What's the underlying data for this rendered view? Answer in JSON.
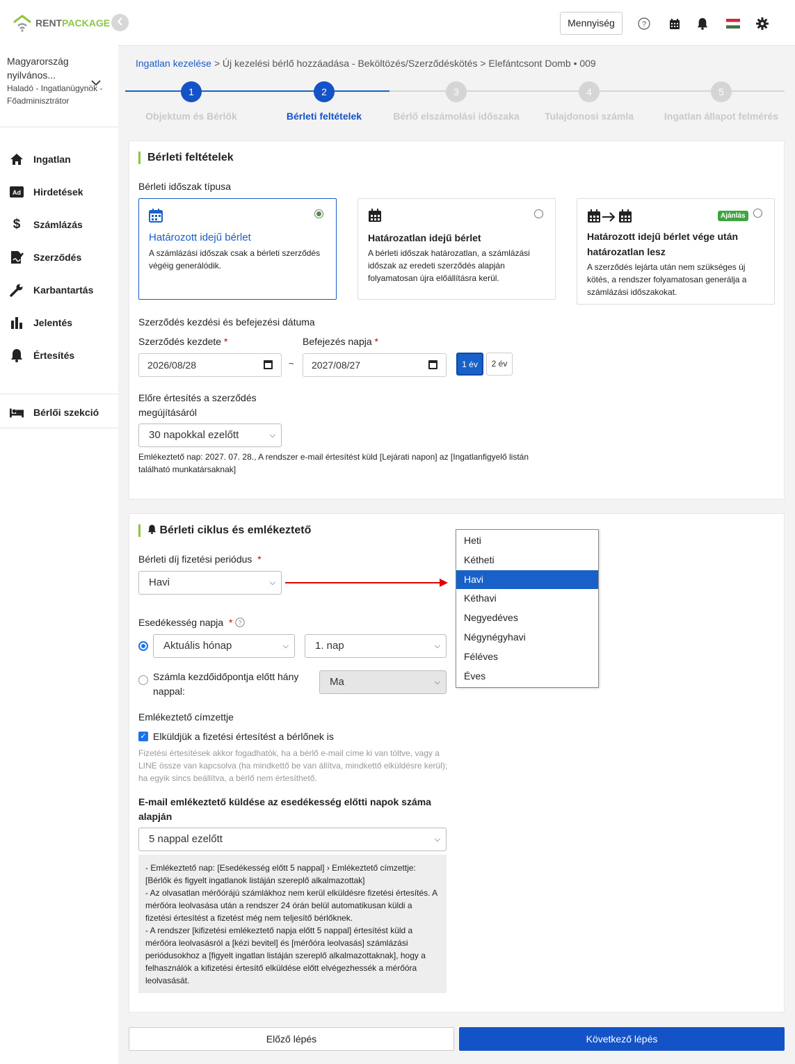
{
  "app": {
    "logo_part1": "RENT",
    "logo_part2": "PACKAGE"
  },
  "sidebar": {
    "org_name": "Magyarország nyilvános...",
    "role": "Haladó - Ingatlanügynök - Főadminisztrátor",
    "items": [
      {
        "label": "Ingatlan",
        "icon": "home-icon"
      },
      {
        "label": "Hirdetések",
        "icon": "ad-icon"
      },
      {
        "label": "Számlázás",
        "icon": "dollar-icon"
      },
      {
        "label": "Szerződés",
        "icon": "contract-icon"
      },
      {
        "label": "Karbantartás",
        "icon": "wrench-icon"
      },
      {
        "label": "Jelentés",
        "icon": "bar-chart-icon"
      },
      {
        "label": "Értesítés",
        "icon": "bell-icon"
      }
    ],
    "tenant_section": "Bérlői szekció"
  },
  "topbar": {
    "quantity_button": "Mennyiség",
    "help": "?"
  },
  "breadcrumb": {
    "root": "Ingatlan kezelése",
    "rest": " > Új kezelési bérlő hozzáadása - Beköltözés/Szerződéskötés > Elefántcsont Domb • 009"
  },
  "steps": [
    {
      "num": "1",
      "label": "Objektum és Bérlők"
    },
    {
      "num": "2",
      "label": "Bérleti feltételek"
    },
    {
      "num": "3",
      "label": "Bérlő elszámolási időszaka"
    },
    {
      "num": "4",
      "label": "Tulajdonosi számla"
    },
    {
      "num": "5",
      "label": "Ingatlan állapot felmérés"
    }
  ],
  "section1": {
    "title": "Bérleti feltételek",
    "period_type_label": "Bérleti időszak típusa",
    "options": [
      {
        "title": "Határozott idejű bérlet",
        "desc": "A számlázási időszak csak a bérleti szerződés végéig generálódik.",
        "selected": true
      },
      {
        "title": "Határozatlan idejű bérlet",
        "desc": "A bérleti időszak határozatlan, a számlázási időszak az eredeti szerződés alapján folyamatosan újra előállításra kerül.",
        "selected": false
      },
      {
        "title": "Határozott idejű bérlet vége után határozatlan lesz",
        "desc": "A szerződés lejárta után nem szükséges új kötés, a rendszer folyamatosan generálja a számlázási időszakokat.",
        "selected": false,
        "badge": "Ajánlás"
      }
    ],
    "dates_label": "Szerződés kezdési és befejezési dátuma",
    "start_label": "Szerződés kezdete",
    "end_label": "Befejezés napja",
    "start_value": "2026/08/28",
    "end_value": "2027/08/27",
    "tilde": "~",
    "year1": "1 év",
    "year2": "2 év",
    "notify_label": "Előre értesítés a szerződés megújításáról",
    "notify_value": "30 napokkal ezelőtt",
    "reminder_note": "Emlékeztető nap: 2027. 07. 28., A rendszer e-mail értesítést küld [Lejárati napon] az [Ingatlanfigyelő listán található munkatársaknak]"
  },
  "section2": {
    "title": "Bérleti ciklus és emlékeztető",
    "payment_period_label": "Bérleti díj fizetési periódus",
    "payment_period_value": "Havi",
    "due_day_label": "Esedékesség napja",
    "due_month_value": "Aktuális hónap",
    "due_day_value": "1. nap",
    "before_label": "Számla kezdőidőpontja előtt hány nappal:",
    "before_value": "Ma",
    "recipient_label": "Emlékeztető címzettje",
    "send_to_tenant": "Elküldjük a fizetési értesítést a bérlőnek is",
    "recipient_note": "Fizetési értesítések akkor fogadhatók, ha a bérlő e-mail címe ki van töltve, vagy a LINE össze van kapcsolva (ha mindkettő be van állítva, mindkettő elküldésre kerül); ha egyik sincs beállítva, a bérlő nem értesíthető.",
    "email_days_label": "E-mail emlékeztető küldése az esedékesség előtti napok száma alapján",
    "email_days_value": "5 nappal ezelőtt",
    "info_lines": [
      "- Emlékeztető nap: [Esedékesség előtt 5 nappal] › Emlékeztető címzettje: [Bérlők és figyelt ingatlanok listáján szereplő alkalmazottak]",
      "- Az olvasatlan mérőórájú számlákhoz nem kerül elküldésre fizetési értesítés. A mérőóra leolvasása után a rendszer 24 órán belül automatikusan küldi a fizetési értesítést a fizetést még nem teljesítő bérlőknek.",
      "- A rendszer [kifizetési emlékeztető napja előtt 5 nappal] értesítést küld a mérőóra leolvasásról a [kézi bevitel] és [mérőóra leolvasás] számlázási periódusokhoz a [figyelt ingatlan listáján szereplő alkalmazottaknak], hogy a felhasználók a kifizetési értesítő elküldése előtt elvégezhessék a mérőóra leolvasását."
    ]
  },
  "dropdown": {
    "options": [
      "Heti",
      "Kétheti",
      "Havi",
      "Kéthavi",
      "Negyedéves",
      "Négynégyhavi",
      "Féléves",
      "Éves"
    ],
    "highlighted": "Havi"
  },
  "footer": {
    "prev": "Előző lépés",
    "next": "Következő lépés"
  },
  "colors": {
    "primary": "#1452c8",
    "accent_green": "#8cc63f",
    "arrow": "#e00000"
  }
}
